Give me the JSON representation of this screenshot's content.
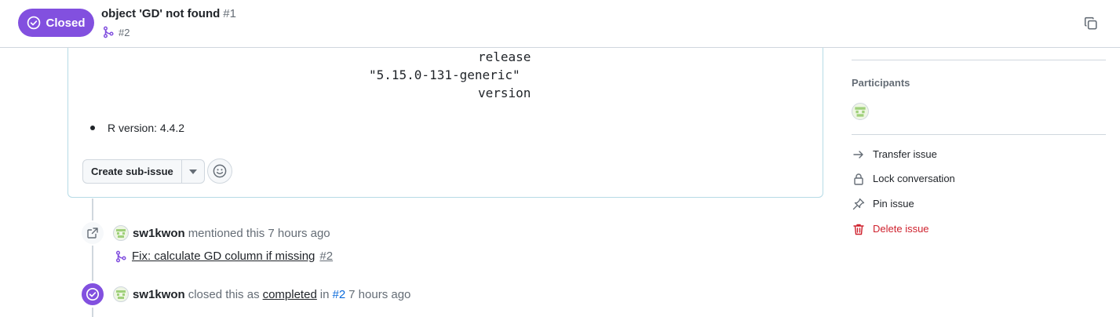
{
  "header": {
    "state": "Closed",
    "title": "object 'GD' not found",
    "number": "#1",
    "linked_pr": "#2"
  },
  "comment": {
    "code_lines": [
      {
        "text": "release",
        "indent": "right"
      },
      {
        "text": "\"5.15.0-131-generic\"",
        "indent": "mid"
      },
      {
        "text": "version",
        "indent": "right"
      }
    ],
    "bullet": "R version: 4.4.2",
    "create_subissue": "Create sub-issue"
  },
  "timeline": {
    "mention": {
      "author": "sw1kwon",
      "action": "mentioned this",
      "time": "7 hours ago",
      "pr_title": "Fix: calculate GD column if missing",
      "pr_number": "#2"
    },
    "closed": {
      "author": "sw1kwon",
      "action": "closed this as",
      "reason": "completed",
      "in_word": "in",
      "ref": "#2",
      "time": "7 hours ago"
    }
  },
  "sidebar": {
    "participants_heading": "Participants",
    "actions": [
      {
        "label": "Transfer issue",
        "icon": "arrow-right-icon"
      },
      {
        "label": "Lock conversation",
        "icon": "lock-icon"
      },
      {
        "label": "Pin issue",
        "icon": "pin-icon"
      },
      {
        "label": "Delete issue",
        "icon": "trash-icon"
      }
    ]
  },
  "colors": {
    "closed_purple": "#8250df",
    "danger_red": "#cf222e",
    "link_blue": "#0969da"
  }
}
